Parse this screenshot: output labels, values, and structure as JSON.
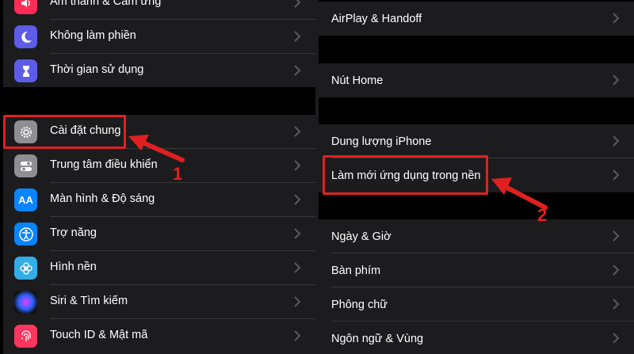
{
  "left_panel": {
    "group1": [
      {
        "label": "Âm thanh & Cảm ứng",
        "icon": "speaker-icon",
        "color": "#ff2d55"
      },
      {
        "label": "Không làm phiền",
        "icon": "moon-icon",
        "color": "#5e5ce6"
      },
      {
        "label": "Thời gian sử dụng",
        "icon": "hourglass-icon",
        "color": "#5e5ce6"
      }
    ],
    "group2": [
      {
        "label": "Cài đặt chung",
        "icon": "gear-icon",
        "color": "#8e8e93"
      },
      {
        "label": "Trung tâm điều khiển",
        "icon": "toggle-icon",
        "color": "#8e8e93"
      },
      {
        "label": "Màn hình & Độ sáng",
        "icon": "text-size-icon",
        "color": "#0a84ff",
        "glyph": "AA"
      },
      {
        "label": "Trợ năng",
        "icon": "accessibility-icon",
        "color": "#0a84ff"
      },
      {
        "label": "Hình nền",
        "icon": "flower-icon",
        "color": "#32ade6"
      },
      {
        "label": "Siri & Tìm kiếm",
        "icon": "siri-icon",
        "color": "#1c1c3c"
      },
      {
        "label": "Touch ID & Mật mã",
        "icon": "fingerprint-icon",
        "color": "#ff375f"
      }
    ]
  },
  "right_panel": {
    "group1": [
      {
        "label": "AirPlay & Handoff"
      }
    ],
    "group2": [
      {
        "label": "Nút Home"
      }
    ],
    "group3": [
      {
        "label": "Dung lượng iPhone"
      },
      {
        "label": "Làm mới ứng dụng trong nền"
      }
    ],
    "group4": [
      {
        "label": "Ngày & Giờ"
      },
      {
        "label": "Bàn phím"
      },
      {
        "label": "Phông chữ"
      },
      {
        "label": "Ngôn ngữ & Vùng"
      }
    ]
  },
  "annotations": {
    "step1": "1",
    "step2": "2",
    "accent_color": "#e02020"
  }
}
